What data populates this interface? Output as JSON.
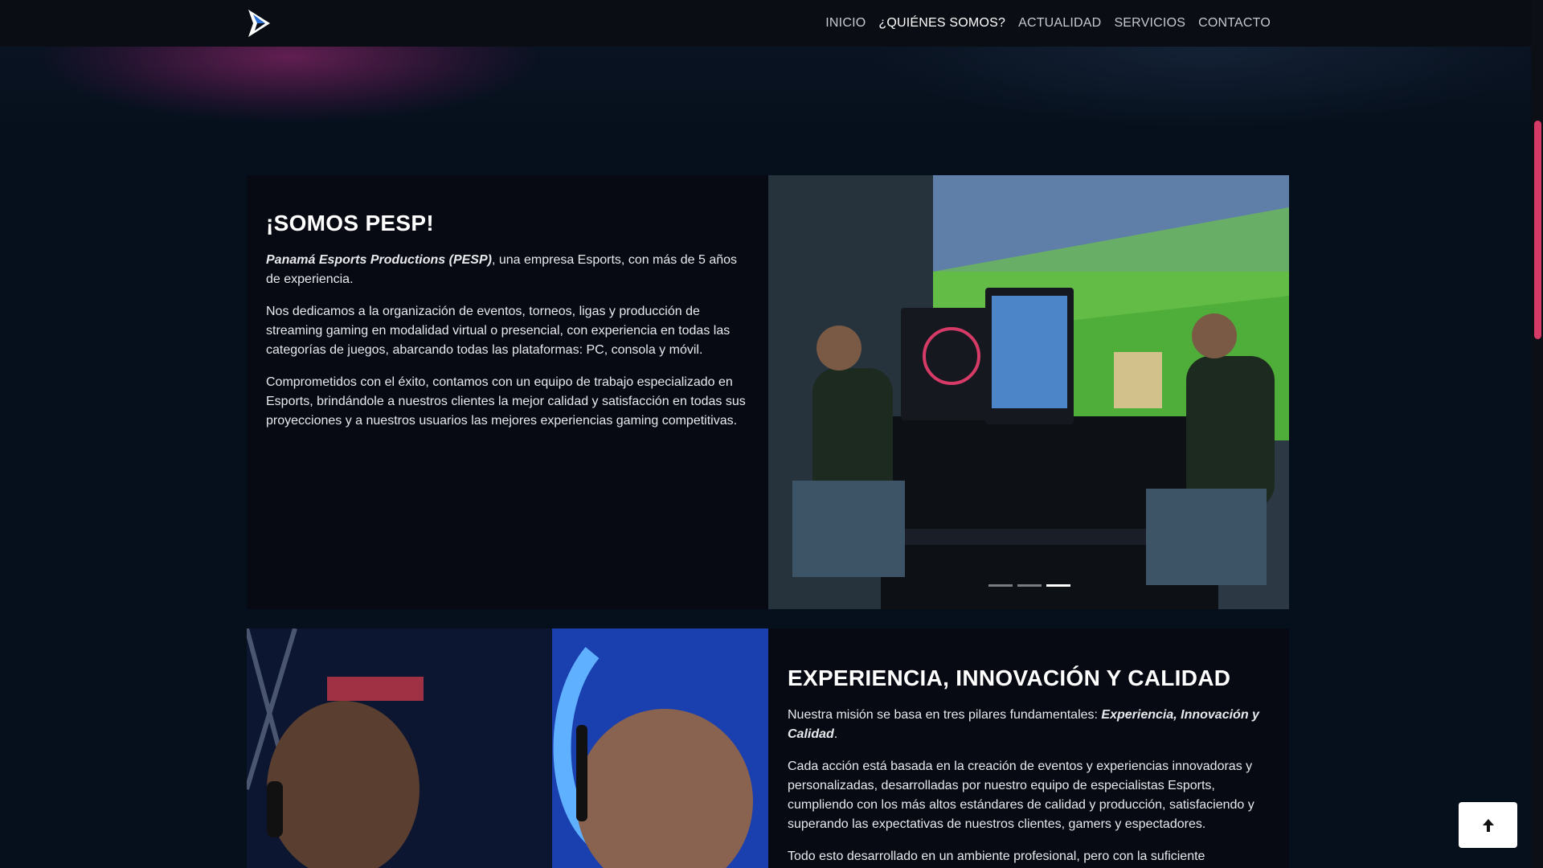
{
  "nav": {
    "items": [
      {
        "label": "INICIO"
      },
      {
        "label": "¿QUIÉNES SOMOS?"
      },
      {
        "label": "ACTUALIDAD"
      },
      {
        "label": "SERVICIOS"
      },
      {
        "label": "CONTACTO"
      }
    ],
    "active_index": 1
  },
  "section1": {
    "heading": "¡SOMOS PESP!",
    "p1_bold": "Panamá Esports Productions (PESP)",
    "p1_rest": ", una empresa Esports, con más de 5 años de experiencia.",
    "p2": "Nos dedicamos a la organización de eventos, torneos, ligas y producción de streaming gaming en modalidad virtual o presencial, con experiencia en todas las categorías de juegos, abarcando todas las plataformas: PC, consola y móvil.",
    "p3": "Comprometidos con el éxito, contamos con un equipo de trabajo especializado en Esports, brindándole a nuestros clientes la mejor calidad y satisfacción en todas sus proyecciones y a nuestros usuarios las mejores experiencias gaming competitivas.",
    "carousel": {
      "slides": 3,
      "active_index": 2
    }
  },
  "section2": {
    "heading": "EXPERIENCIA, INNOVACIÓN Y CALIDAD",
    "p1_start": "Nuestra misión se basa en tres pilares fundamentales: ",
    "p1_bold": "Experiencia, Innovación y Calidad",
    "p1_end": ".",
    "p2": "Cada acción está basada en la creación de eventos y experiencias innovadoras y personalizadas, desarrolladas por nuestro equipo de especialistas Esports, cumpliendo con los más altos estándares de calidad y producción, satisfaciendo y superando las expectativas de nuestros clientes, gamers y espectadores.",
    "p3": "Todo esto desarrollado en un ambiente profesional, pero con la suficiente"
  },
  "colors": {
    "accent": "#d63a67",
    "page_bg": "#06101c",
    "card_bg": "#070a12",
    "nav_bg": "#0a0d14"
  },
  "icons": {
    "logo": "pesp-logo",
    "back_to_top": "arrow-up-icon"
  }
}
